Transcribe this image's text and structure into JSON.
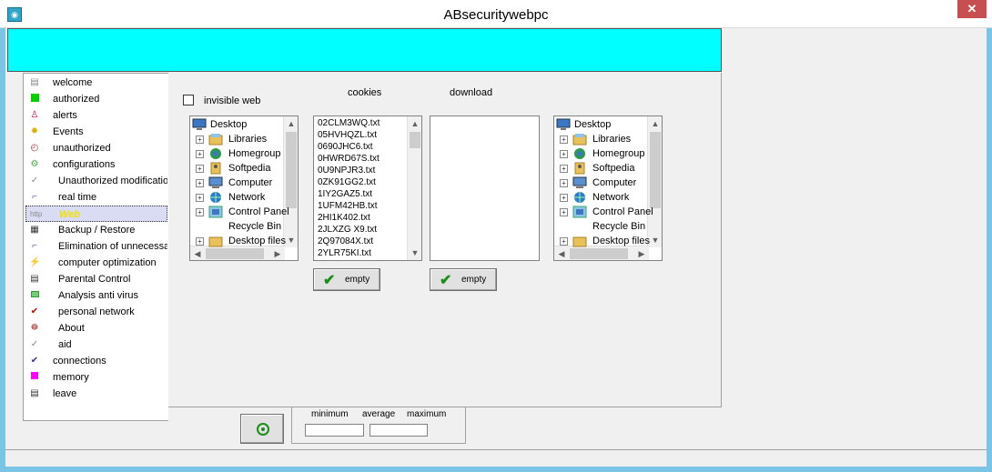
{
  "window": {
    "title": "ABsecuritywebpc",
    "close_label": "✕"
  },
  "nav": {
    "items": [
      {
        "label": "welcome",
        "icon": "welcome-icon"
      },
      {
        "label": "authorized",
        "icon": "green-square-icon"
      },
      {
        "label": "alerts",
        "icon": "alert-figure-icon"
      },
      {
        "label": "Events",
        "icon": "bulb-icon"
      },
      {
        "label": "unauthorized",
        "icon": "clock-icon"
      },
      {
        "label": "configurations",
        "icon": "config-icon"
      },
      {
        "label": "Unauthorized modification",
        "icon": "tick-icon"
      },
      {
        "label": "real time",
        "icon": "realtime-icon"
      },
      {
        "label": "Web",
        "icon": "web-icon"
      },
      {
        "label": "Backup / Restore",
        "icon": "backup-icon"
      },
      {
        "label": "Elimination of unnecessary",
        "icon": "elimination-icon"
      },
      {
        "label": "computer optimization",
        "icon": "optimization-icon"
      },
      {
        "label": "Parental Control",
        "icon": "parental-icon"
      },
      {
        "label": "Analysis anti virus",
        "icon": "green-rect-icon"
      },
      {
        "label": "personal network",
        "icon": "check-red-icon"
      },
      {
        "label": "About",
        "icon": "about-icon"
      },
      {
        "label": "aid",
        "icon": "aid-icon"
      },
      {
        "label": "connections",
        "icon": "check-icon"
      },
      {
        "label": "memory",
        "icon": "magenta-square-icon"
      },
      {
        "label": "leave",
        "icon": "leave-icon"
      }
    ],
    "selected_index": 8
  },
  "main": {
    "invisible_web_label": "invisible web",
    "invisible_web_checked": false,
    "cookies_header": "cookies",
    "download_header": "download",
    "empty_label": "empty",
    "left_tree": [
      "Desktop",
      "Libraries",
      "Homegroup",
      "Softpedia",
      "Computer",
      "Network",
      "Control Panel",
      "Recycle Bin",
      "Desktop files"
    ],
    "right_tree": [
      "Desktop",
      "Libraries",
      "Homegroup",
      "Softpedia",
      "Computer",
      "Network",
      "Control Panel",
      "Recycle Bin",
      "Desktop files"
    ],
    "cookies": [
      "02CLM3WQ.txt",
      "05HVHQZL.txt",
      "0690JHC6.txt",
      "0HWRD67S.txt",
      "0U9NPJR3.txt",
      "0ZK91GG2.txt",
      "1IY2GAZ5.txt",
      "1UFM42HB.txt",
      "2HI1K402.txt",
      "2JLXZG X9.txt",
      "2Q97084X.txt",
      "2YLR75KI.txt"
    ],
    "downloads": []
  },
  "stats": {
    "minimum_label": "minimum",
    "average_label": "average",
    "maximum_label": "maximum",
    "minimum_value": "",
    "maximum_value": ""
  },
  "colors": {
    "cyan_bar": "#00ffff",
    "selected_item_text": "#f0e000",
    "close_button": "#c74f4f"
  }
}
